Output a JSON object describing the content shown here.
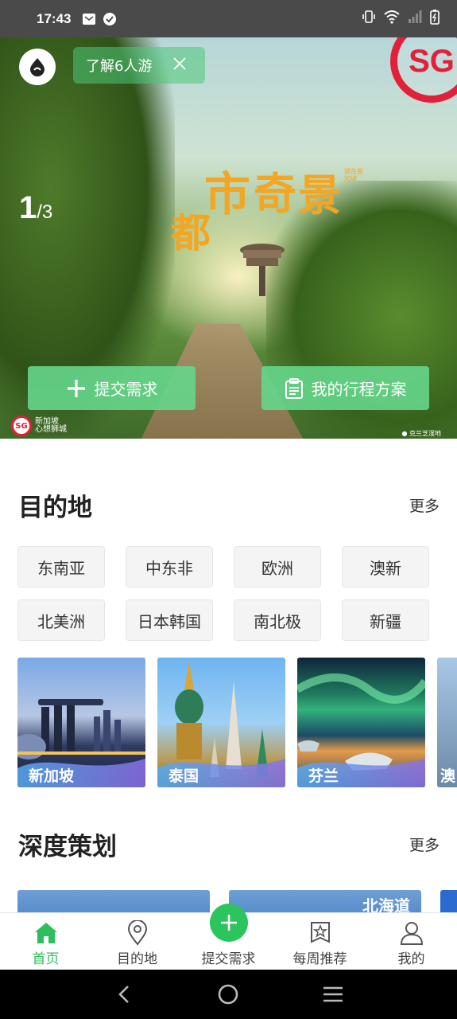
{
  "status_bar": {
    "time": "17:43"
  },
  "hero": {
    "promo_chip": "了解6人游",
    "counter_current": "1",
    "counter_total": "/3",
    "headline_chars": [
      "都",
      "市",
      "奇",
      "景"
    ],
    "headline_small": "就在新加坡",
    "sg_badge": "SG",
    "submit_button": "提交需求",
    "plan_button": "我的行程方案",
    "foot_logo_text": "新加坡",
    "foot_logo_sub": "心想狮城",
    "foot_location": "克兰芝湿地"
  },
  "destinations": {
    "title": "目的地",
    "more": "更多",
    "regions": [
      "东南亚",
      "中东非",
      "欧洲",
      "澳新",
      "北美洲",
      "日本韩国",
      "南北极",
      "新疆"
    ],
    "cards": [
      "新加坡",
      "泰国",
      "芬兰",
      "澳"
    ]
  },
  "deep_planning": {
    "title": "深度策划",
    "more": "更多",
    "cards": [
      "",
      "北海道"
    ]
  },
  "tabbar": {
    "items": [
      {
        "label": "首页",
        "icon": "home-icon",
        "active": true
      },
      {
        "label": "目的地",
        "icon": "location-pin-icon",
        "active": false
      },
      {
        "label": "提交需求",
        "icon": "plus-icon",
        "active": false
      },
      {
        "label": "每周推荐",
        "icon": "star-badge-icon",
        "active": false
      },
      {
        "label": "我的",
        "icon": "person-icon",
        "active": false
      }
    ]
  },
  "colors": {
    "accent": "#2cc45c",
    "hero_button": "#65d68b",
    "headline": "#f2a623",
    "sg_red": "#e2203a"
  }
}
